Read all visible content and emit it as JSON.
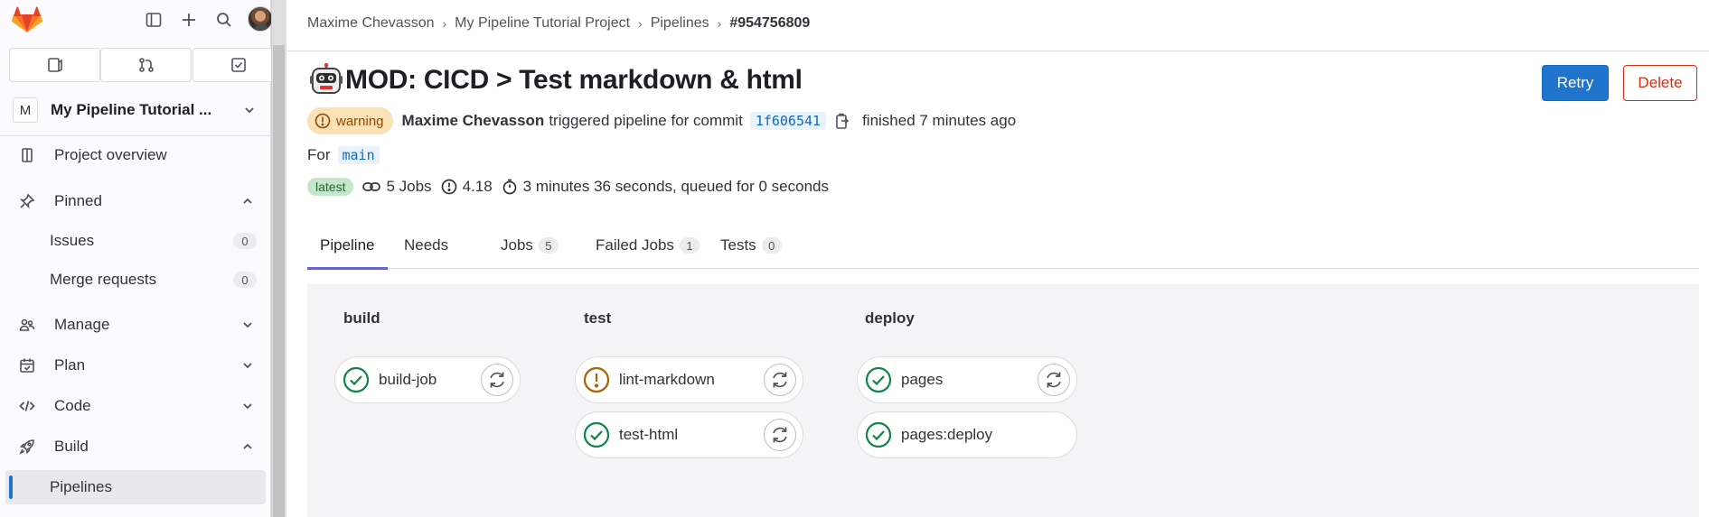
{
  "sidebar": {
    "logo": "gitlab-tanuki-logo",
    "top_icons": [
      "sidebar-toggle-icon",
      "plus-icon",
      "search-icon"
    ],
    "project": {
      "avatar_letter": "M",
      "name": "My Pipeline Tutorial ..."
    },
    "nav": {
      "project_overview": "Project overview",
      "pinned": "Pinned",
      "issues": "Issues",
      "issues_count": "0",
      "merge_requests": "Merge requests",
      "merge_requests_count": "0",
      "manage": "Manage",
      "plan": "Plan",
      "code": "Code",
      "build": "Build",
      "pipelines": "Pipelines"
    }
  },
  "breadcrumb": {
    "items": [
      "Maxime Chevasson",
      "My Pipeline Tutorial Project",
      "Pipelines"
    ],
    "current": "#954756809",
    "separator": "›"
  },
  "header": {
    "title": "MOD: CICD > Test markdown & html",
    "retry_label": "Retry",
    "delete_label": "Delete"
  },
  "pipeline": {
    "status": "warning",
    "author": "Maxime Chevasson",
    "triggered_text": "triggered pipeline for commit",
    "commit_sha": "1f606541",
    "finished_text": "finished 7 minutes ago",
    "for_label": "For",
    "ref": "main",
    "latest_badge": "latest",
    "jobs_text": "5 Jobs",
    "version": "4.18",
    "duration_text": "3 minutes 36 seconds, queued for 0 seconds"
  },
  "tabs": [
    {
      "label": "Pipeline",
      "count": null,
      "active": true
    },
    {
      "label": "Needs",
      "count": null
    },
    {
      "label": "Jobs",
      "count": "5"
    },
    {
      "label": "Failed Jobs",
      "count": "1"
    },
    {
      "label": "Tests",
      "count": "0"
    }
  ],
  "stages": [
    {
      "name": "build",
      "jobs": [
        {
          "name": "build-job",
          "status": "success"
        }
      ]
    },
    {
      "name": "test",
      "jobs": [
        {
          "name": "lint-markdown",
          "status": "warning"
        },
        {
          "name": "test-html",
          "status": "success"
        }
      ]
    },
    {
      "name": "deploy",
      "jobs": [
        {
          "name": "pages",
          "status": "success"
        },
        {
          "name": "pages:deploy",
          "status": "success"
        }
      ]
    }
  ],
  "colors": {
    "primary": "#1f75cb",
    "danger": "#dd2b0e",
    "success": "#108548",
    "warning": "#ab6100",
    "tab_active": "#6666c4"
  }
}
